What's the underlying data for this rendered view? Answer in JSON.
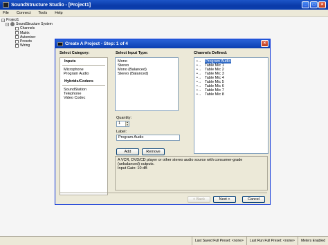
{
  "app": {
    "title": "SoundStructure Studio - [Project1]",
    "menu": [
      "File",
      "Connect",
      "Tools",
      "Help"
    ]
  },
  "tree": {
    "root": "Project1",
    "system": "SoundStructure System",
    "children": [
      "Channels",
      "Matrix",
      "Automixer",
      "Presets",
      "Wiring"
    ]
  },
  "dialog": {
    "title": "Create A Project - Step: 1 of 4",
    "category_header": "Select Category:",
    "input_header": "Select Input Type:",
    "channels_header": "Channels Defined:",
    "categories": {
      "inputs_title": "Inputs",
      "inputs": [
        "Microphone",
        "Program Audio"
      ],
      "hybrids_title": "Hybrids/Codecs",
      "hybrids": [
        "SoundStation",
        "Telephone",
        "Video Codec"
      ]
    },
    "input_types": [
      "Mono",
      "Stereo",
      "Mono (Balanced)",
      "Stereo (Balanced)"
    ],
    "quantity_label": "Quantity:",
    "quantity_value": "1",
    "label_label": "Label:",
    "label_value": "Program Audio",
    "add_label": "Add",
    "remove_label": "Remove",
    "description_line1": "A VCR, DVD/CD player or other stereo audio source with consumer-grade (unbalanced) outputs.",
    "description_line2": "Input Gain: 10 dB",
    "channels": [
      "Program Audio",
      "Table Mic 1",
      "Table Mic 2",
      "Table Mic 3",
      "Table Mic 4",
      "Table Mic 5",
      "Table Mic 6",
      "Table Mic 7",
      "Table Mic 8"
    ],
    "back_label": "< Back",
    "next_label": "Next >",
    "cancel_label": "Cancel"
  },
  "status": {
    "last_saved": "Last Saved Full Preset: <none>",
    "last_run": "Last Run Full Preset: <none>",
    "meters": "Meters Enabled"
  },
  "colors": {
    "titlebar": "#0b3fb0",
    "selection": "#316ac5",
    "dialog_bg": "#ece9d8"
  }
}
